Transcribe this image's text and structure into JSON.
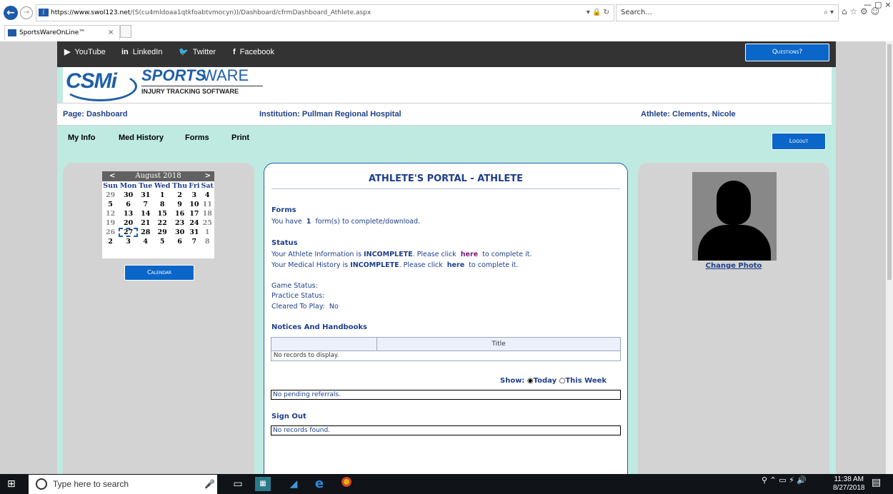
{
  "browser": {
    "url_host": "https://www.swol123.net",
    "url_path": "/(S(cu4mldoaa1qtkfoabtvmocyn))/Dashboard/cfrmDashboard_Athlete.aspx",
    "address_tools": "▾ 🔒 ↻",
    "search_placeholder": "Search...",
    "search_icon": "⌕ ▾",
    "tab_title": "SportsWareOnLine™",
    "tab_close": "×",
    "back_icon": "←",
    "forward_icon": "→",
    "window_controls": [
      "—",
      "▢",
      "×"
    ],
    "toolbar_icons": "⌂ ☆ ⚙ ☺"
  },
  "social": {
    "youtube": "YouTube",
    "linkedin": "LinkedIn",
    "twitter": "Twitter",
    "facebook": "Facebook",
    "youtube_icon": "▶",
    "linkedin_icon": "in",
    "twitter_icon": "🐦",
    "facebook_icon": "f"
  },
  "questions_button": "Questions?",
  "logo": {
    "csmi": "CSMi",
    "sports": "SPORTS",
    "ware": "WARE",
    "subtitle": "INJURY TRACKING SOFTWARE"
  },
  "info_bar": {
    "page": "Page: Dashboard",
    "institution": "Institution: Pullman Regional Hospital",
    "athlete": "Athlete: Clements, Nicole"
  },
  "menu": [
    "My Info",
    "Med History",
    "Forms",
    "Print"
  ],
  "logout_button": "Logout",
  "calendar": {
    "prev": "<",
    "next": ">",
    "month": "August 2018",
    "days": [
      "Sun",
      "Mon",
      "Tue",
      "Wed",
      "Thu",
      "Fri",
      "Sat"
    ],
    "weeks": [
      [
        {
          "d": "29",
          "o": true
        },
        {
          "d": "30"
        },
        {
          "d": "31"
        },
        {
          "d": "1"
        },
        {
          "d": "2"
        },
        {
          "d": "3"
        },
        {
          "d": "4"
        }
      ],
      [
        {
          "d": "5"
        },
        {
          "d": "6"
        },
        {
          "d": "7"
        },
        {
          "d": "8"
        },
        {
          "d": "9"
        },
        {
          "d": "10"
        },
        {
          "d": "11",
          "o": true
        }
      ],
      [
        {
          "d": "12",
          "o": true
        },
        {
          "d": "13"
        },
        {
          "d": "14"
        },
        {
          "d": "15"
        },
        {
          "d": "16"
        },
        {
          "d": "17"
        },
        {
          "d": "18",
          "o": true
        }
      ],
      [
        {
          "d": "19",
          "o": true
        },
        {
          "d": "20"
        },
        {
          "d": "21"
        },
        {
          "d": "22"
        },
        {
          "d": "23"
        },
        {
          "d": "24"
        },
        {
          "d": "25",
          "o": true
        }
      ],
      [
        {
          "d": "26",
          "o": true
        },
        {
          "d": "27",
          "sel": true
        },
        {
          "d": "28"
        },
        {
          "d": "29"
        },
        {
          "d": "30"
        },
        {
          "d": "31"
        },
        {
          "d": "1",
          "o": true
        }
      ],
      [
        {
          "d": "2"
        },
        {
          "d": "3"
        },
        {
          "d": "4"
        },
        {
          "d": "5"
        },
        {
          "d": "6"
        },
        {
          "d": "7"
        },
        {
          "d": "8",
          "o": true
        }
      ]
    ],
    "button": "Calendar"
  },
  "portal": {
    "title": "ATHLETE'S PORTAL - ATHLETE",
    "forms_heading": "Forms",
    "forms_text_pre": "You have",
    "forms_count": "1",
    "forms_text_post": "form(s) to complete/download.",
    "status_heading": "Status",
    "athlete_info_pre": "Your Athlete Information is",
    "athlete_info_status": "INCOMPLETE",
    "athlete_info_mid": ". Please click",
    "athlete_info_link": "here",
    "athlete_info_post": "to complete it.",
    "med_history_pre": "Your Medical History is",
    "med_history_status": "INCOMPLETE",
    "med_history_mid": ". Please click",
    "med_history_link": "here",
    "med_history_post": "to complete it.",
    "game_status": "Game Status:",
    "practice_status": "Practice Status:",
    "cleared_label": "Cleared To Play:",
    "cleared_value": "No",
    "notices_heading": "Notices And Handbooks",
    "notices_col_title": "Title",
    "notices_empty": "No records to display.",
    "show_label": "Show:",
    "show_today": "Today",
    "show_week": "This Week",
    "show_selected": "Today",
    "referrals_empty": "No pending referrals.",
    "signout_heading": "Sign Out",
    "signout_empty": "No records found."
  },
  "right_panel": {
    "change_photo": "Change Photo"
  },
  "taskbar": {
    "start_icon": "⊞",
    "search_placeholder": "Type here to search",
    "mic_icon": "🎤",
    "tray": "⚲  ⌃  ▭  ⚡  🔊",
    "time": "11:38 AM",
    "date": "8/27/2018",
    "notif_icon": "▤"
  }
}
